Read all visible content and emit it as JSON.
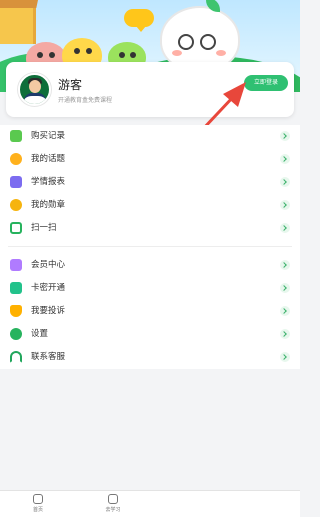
{
  "profile": {
    "name": "游客",
    "subtitle": "开通教育盒免费课程",
    "login_button": "立即登录"
  },
  "menu": {
    "group1": [
      {
        "label": "购买记录",
        "icon": "purchase-record-icon"
      },
      {
        "label": "我的话题",
        "icon": "topic-chat-icon"
      },
      {
        "label": "学情报表",
        "icon": "report-robot-icon"
      },
      {
        "label": "我的勋章",
        "icon": "medal-icon"
      },
      {
        "label": "扫一扫",
        "icon": "scan-icon"
      }
    ],
    "group2": [
      {
        "label": "会员中心",
        "icon": "vip-icon"
      },
      {
        "label": "卡密开通",
        "icon": "card-icon"
      },
      {
        "label": "我要投诉",
        "icon": "complaint-shield-icon"
      },
      {
        "label": "设置",
        "icon": "settings-icon"
      },
      {
        "label": "联系客服",
        "icon": "headset-icon"
      }
    ]
  },
  "bottom_nav": [
    {
      "label": "首页",
      "icon": "home-icon"
    },
    {
      "label": "去学习",
      "icon": "study-icon"
    }
  ],
  "colors": {
    "accent": "#2fc072",
    "arrow": "#e8473b"
  }
}
